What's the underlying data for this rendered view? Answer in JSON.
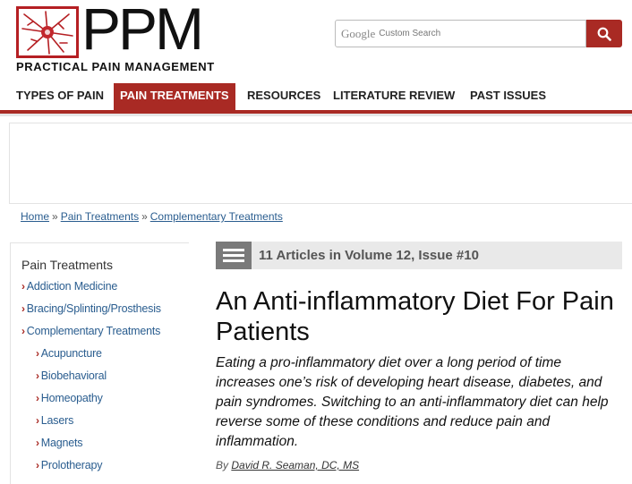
{
  "logo": {
    "letters": "PPM",
    "subtitle": "PRACTICAL PAIN MANAGEMENT"
  },
  "search": {
    "brand": "Google",
    "placeholder": "Custom Search",
    "button_icon": "magnifier-icon"
  },
  "nav": {
    "items": [
      {
        "label": "TYPES OF PAIN"
      },
      {
        "label": "PAIN TREATMENTS",
        "active": true
      },
      {
        "label": "RESOURCES"
      },
      {
        "label": "LITERATURE REVIEW"
      },
      {
        "label": "PAST ISSUES"
      }
    ]
  },
  "breadcrumb": {
    "items": [
      "Home",
      "Pain Treatments",
      "Complementary Treatments"
    ],
    "separator": "»"
  },
  "sidebar": {
    "title": "Pain Treatments",
    "items": [
      {
        "label": "Addiction Medicine"
      },
      {
        "label": "Bracing/Splinting/Prosthesis"
      },
      {
        "label": "Complementary Treatments"
      },
      {
        "label": "Acupuncture"
      },
      {
        "label": "Biobehavioral"
      },
      {
        "label": "Homeopathy"
      },
      {
        "label": "Lasers"
      },
      {
        "label": "Magnets"
      },
      {
        "label": "Prolotherapy"
      }
    ]
  },
  "issue_bar": {
    "text": "11 Articles in Volume 12, Issue #10"
  },
  "article": {
    "title": "An Anti-inflammatory Diet For Pain Patients",
    "dek": "Eating a pro-inflammatory diet over a long period of time increases one’s risk of developing heart disease, diabetes, and pain syndromes. Switching to an anti-inflammatory diet can help reverse some of these conditions and reduce pain and inflammation.",
    "by_label": "By",
    "author": "David R. Seaman, DC, MS"
  },
  "colors": {
    "brand_red": "#a92a24",
    "link_blue": "#2a5d8f"
  }
}
